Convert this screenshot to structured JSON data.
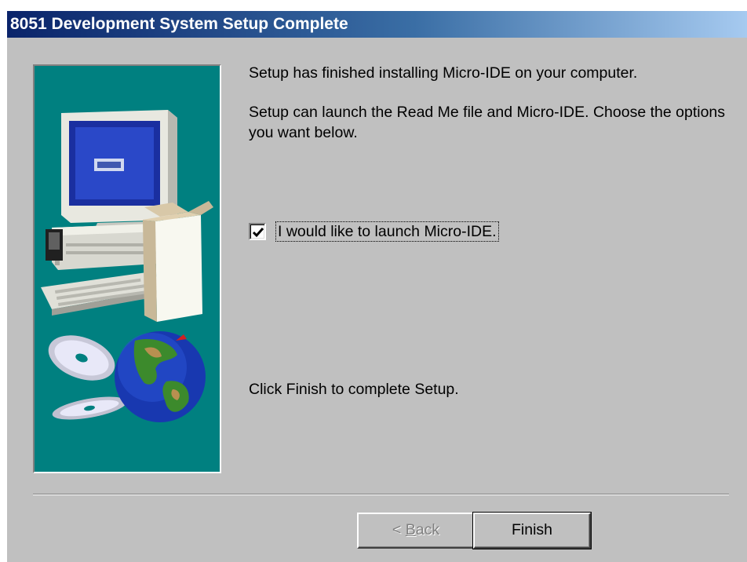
{
  "window": {
    "title": "8051 Development System Setup Complete"
  },
  "content": {
    "finished_text": "Setup has finished installing Micro-IDE on your computer.",
    "options_text": "Setup can launch the Read Me file and Micro-IDE.  Choose the options you want below.",
    "finish_prompt": "Click Finish to complete Setup."
  },
  "options": {
    "launch_checkbox": {
      "label": "I would like to launch Micro-IDE.",
      "checked": true
    }
  },
  "buttons": {
    "back_label": "< Back",
    "back_enabled": false,
    "finish_label": "Finish"
  },
  "colors": {
    "dialog_bg": "#c0c0c0",
    "title_gradient_start": "#0a246a",
    "illustration_bg": "#008080"
  },
  "icons": {
    "illustration": "computer-box-globe-cd-illustration",
    "checkmark": "checkmark-icon"
  }
}
